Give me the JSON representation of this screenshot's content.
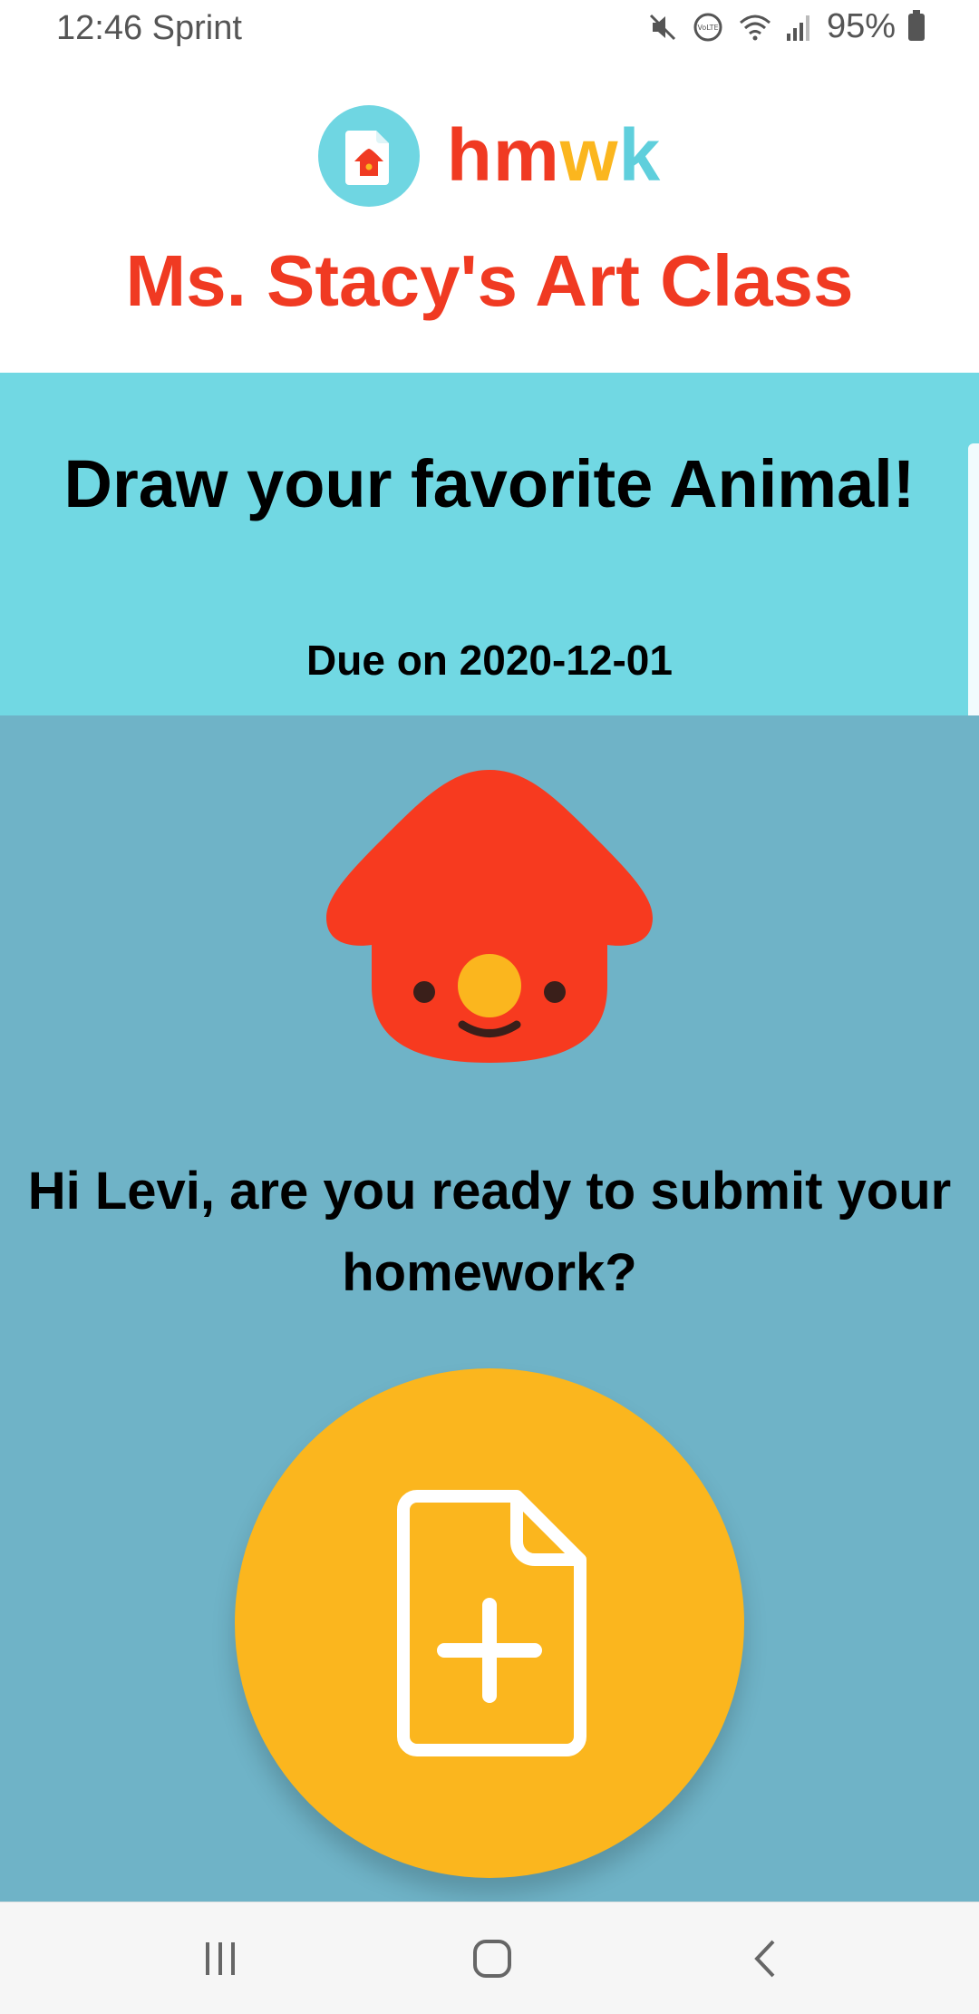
{
  "status_bar": {
    "time": "12:46",
    "carrier": "Sprint",
    "battery": "95%",
    "icons": [
      "mute-icon",
      "volte-icon",
      "wifi-icon",
      "signal-icon",
      "battery-icon"
    ]
  },
  "header": {
    "logo_letters": [
      {
        "char": "h",
        "color": "#f03a22"
      },
      {
        "char": "m",
        "color": "#f03a22"
      },
      {
        "char": "w",
        "color": "#fbb61e"
      },
      {
        "char": "k",
        "color": "#5fcfdc"
      }
    ],
    "class_title": "Ms. Stacy's Art Class"
  },
  "assignment": {
    "title": "Draw your favorite Animal!",
    "due": "Due on 2020-12-01"
  },
  "main": {
    "greeting": "Hi Levi, are you ready to submit your homework?",
    "submit_icon": "add-file-icon"
  },
  "nav": {
    "icons": [
      "recents-icon",
      "home-icon",
      "back-icon"
    ]
  },
  "colors": {
    "brand_red": "#f03a22",
    "brand_yellow": "#fbb61e",
    "brand_cyan": "#71d8e3",
    "main_bg": "#6fb3c7"
  }
}
